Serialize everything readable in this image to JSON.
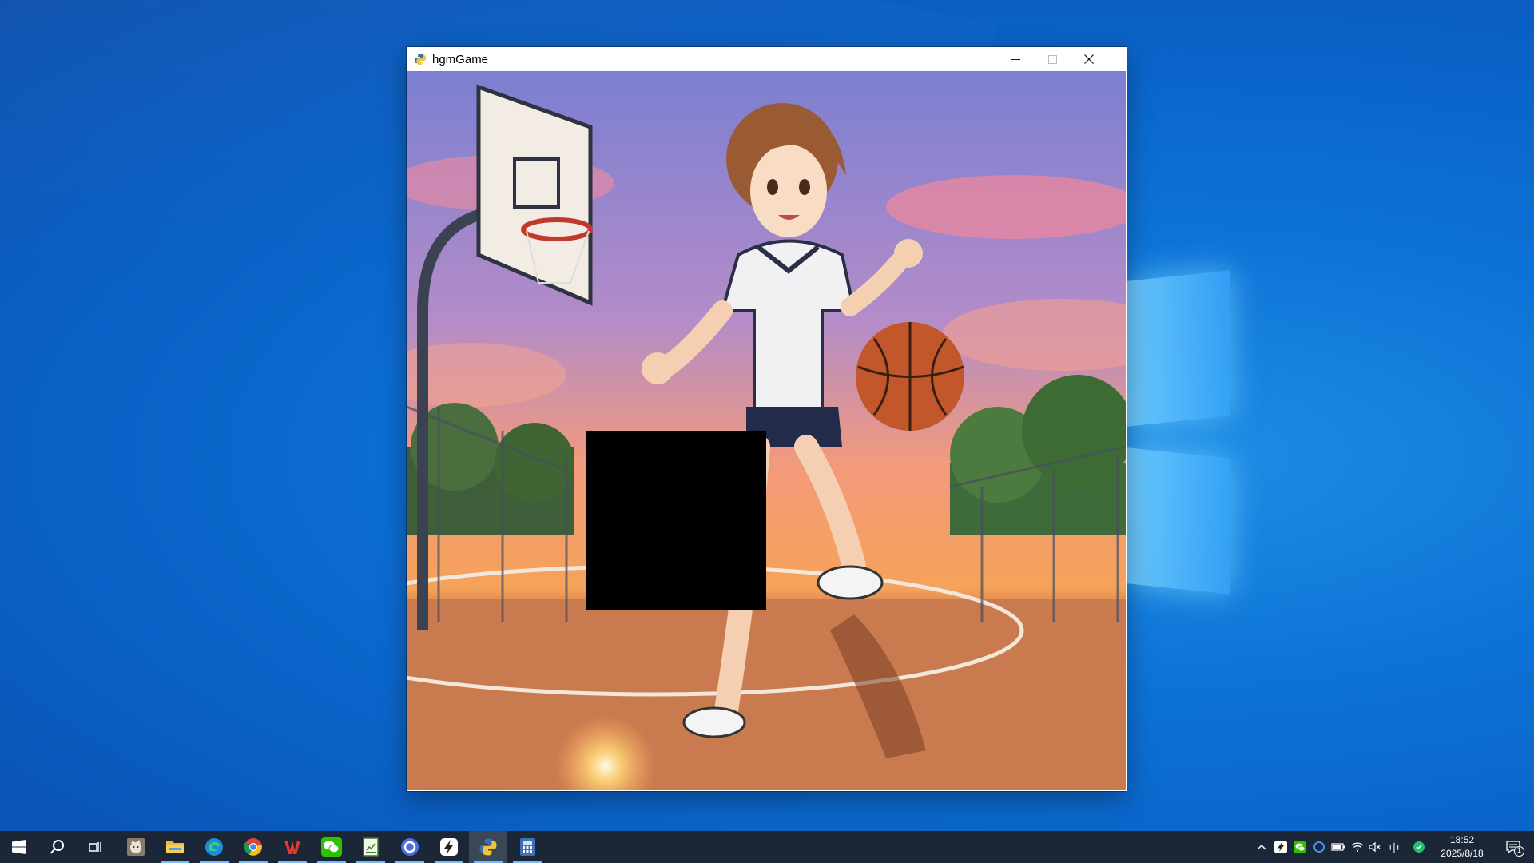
{
  "window": {
    "title": "hgmGame",
    "icon": "python-snake-icon",
    "controls": [
      "minimize-icon",
      "maximize-icon",
      "close-icon"
    ]
  },
  "puzzle": {
    "grid_size": 4,
    "image": "anime girl dribbling basketball on outdoor court at sunset",
    "blank_tile": {
      "row": 2,
      "col": 1
    },
    "colors": {
      "blank": "#000000",
      "sky_top": "#7c7fd1",
      "sunset": "#f5a25a",
      "court": "#c8704a"
    }
  },
  "taskbar": {
    "pinned": [
      {
        "icon": "start-windows-icon"
      },
      {
        "icon": "search-icon"
      },
      {
        "icon": "task-view-icon"
      },
      {
        "icon": "cat-photo-app-icon"
      },
      {
        "icon": "file-explorer-icon"
      },
      {
        "icon": "edge-browser-icon"
      },
      {
        "icon": "chrome-browser-icon"
      },
      {
        "icon": "wps-office-icon"
      },
      {
        "icon": "wechat-icon"
      },
      {
        "icon": "spreadsheet-app-icon"
      },
      {
        "icon": "blue-circle-app-icon"
      },
      {
        "icon": "lightning-app-icon"
      },
      {
        "icon": "python-snake-icon"
      },
      {
        "icon": "calculator-icon"
      }
    ],
    "tray": {
      "icons": [
        "chevron-up-icon",
        "lightning-tray-icon",
        "wechat-tray-icon",
        "circle-tray-icon",
        "battery-icon",
        "wifi-icon",
        "volume-muted-icon"
      ],
      "ime": "中",
      "ime_icon": "green-app-tray-icon"
    },
    "clock": {
      "time": "18:52",
      "date": "2025/8/18"
    },
    "notification_badge": "1"
  }
}
